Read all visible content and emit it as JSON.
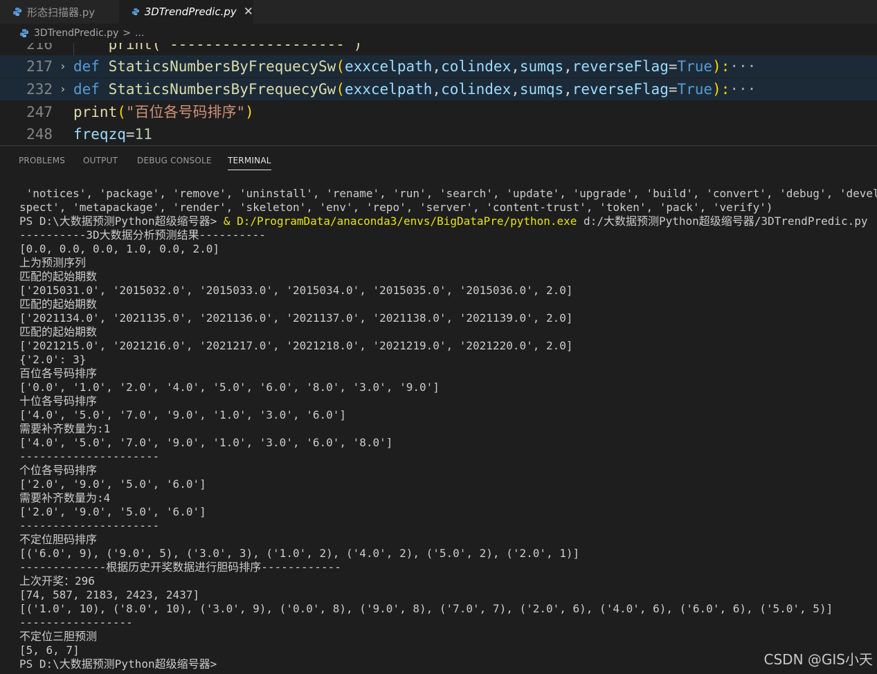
{
  "tabs": [
    {
      "label": "形态扫描器.py",
      "active": false
    },
    {
      "label": "3DTrendPredic.py",
      "active": true,
      "close": "✕"
    }
  ],
  "breadcrumb": {
    "file": "3DTrendPredic.py",
    "sep": ">",
    "rest": "..."
  },
  "editor": {
    "lines": [
      {
        "no": "216",
        "code": "    print(\"--------------------\")"
      },
      {
        "no": "217",
        "def_kw": "def",
        "fn": "StaticsNumbersByFrequecySw",
        "open": "(",
        "params": [
          "exxcelpath",
          "colindex",
          "sumqs",
          "reverseFlag"
        ],
        "eq": "=",
        "true_kw": "True",
        "close": "):",
        "ellipsis": "···"
      },
      {
        "no": "232",
        "def_kw": "def",
        "fn": "StaticsNumbersByFrequecyGw",
        "open": "(",
        "params": [
          "exxcelpath",
          "colindex",
          "sumqs",
          "reverseFlag"
        ],
        "eq": "=",
        "true_kw": "True",
        "close": "):",
        "ellipsis": "···"
      },
      {
        "no": "247",
        "fn": "print",
        "open": "(",
        "str": "\"百位各号码排序\"",
        "close": ")"
      },
      {
        "no": "248",
        "var": "freqzq",
        "eq": "=",
        "num": "11"
      }
    ]
  },
  "panel_tabs": [
    {
      "label": "PROBLEMS",
      "active": false
    },
    {
      "label": "OUTPUT",
      "active": false
    },
    {
      "label": "DEBUG CONSOLE",
      "active": false
    },
    {
      "label": "TERMINAL",
      "active": true
    }
  ],
  "terminal": {
    "prompt_prefix": "PS D:\\大数据预测Python超级缩号器> ",
    "run_cmd": "& D:/ProgramData/anaconda3/envs/BigDataPre/python.exe",
    "run_arg": " d:/大数据预测Python超级缩号器/3DTrendPredic.py",
    "final_prompt": "PS D:\\大数据预测Python超级缩号器>",
    "lines": [
      " 'notices', 'package', 'remove', 'uninstall', 'rename', 'run', 'search', 'update', 'upgrade', 'build', 'convert', 'debug', 'develop', 'doc",
      "spect', 'metapackage', 'render', 'skeleton', 'env', 'repo', 'server', 'content-trust', 'token', 'pack', 'verify')",
      "----------3D大数据分析预测结果----------",
      "[0.0, 0.0, 0.0, 1.0, 0.0, 2.0]",
      "上为预测序列",
      "匹配的起始期数",
      "['2015031.0', '2015032.0', '2015033.0', '2015034.0', '2015035.0', '2015036.0', 2.0]",
      "匹配的起始期数",
      "['2021134.0', '2021135.0', '2021136.0', '2021137.0', '2021138.0', '2021139.0', 2.0]",
      "匹配的起始期数",
      "['2021215.0', '2021216.0', '2021217.0', '2021218.0', '2021219.0', '2021220.0', 2.0]",
      "{'2.0': 3}",
      "百位各号码排序",
      "['0.0', '1.0', '2.0', '4.0', '5.0', '6.0', '8.0', '3.0', '9.0']",
      "十位各号码排序",
      "['4.0', '5.0', '7.0', '9.0', '1.0', '3.0', '6.0']",
      "需要补齐数量为:1",
      "['4.0', '5.0', '7.0', '9.0', '1.0', '3.0', '6.0', '8.0']",
      "---------------------",
      "个位各号码排序",
      "['2.0', '9.0', '5.0', '6.0']",
      "需要补齐数量为:4",
      "['2.0', '9.0', '5.0', '6.0']",
      "---------------------",
      "不定位胆码排序",
      "[('6.0', 9), ('9.0', 5), ('3.0', 3), ('1.0', 2), ('4.0', 2), ('5.0', 2), ('2.0', 1)]",
      "-------------根据历史开奖数据进行胆码排序------------",
      "上次开奖：296",
      "[74, 587, 2183, 2423, 2437]",
      "[('1.0', 10), ('8.0', 10), ('3.0', 9), ('0.0', 8), ('9.0', 8), ('7.0', 7), ('2.0', 6), ('4.0', 6), ('6.0', 6), ('5.0', 5)]",
      "-----------------",
      "不定位三胆预测",
      "[5, 6, 7]"
    ]
  },
  "watermark": "CSDN @GIS小天"
}
